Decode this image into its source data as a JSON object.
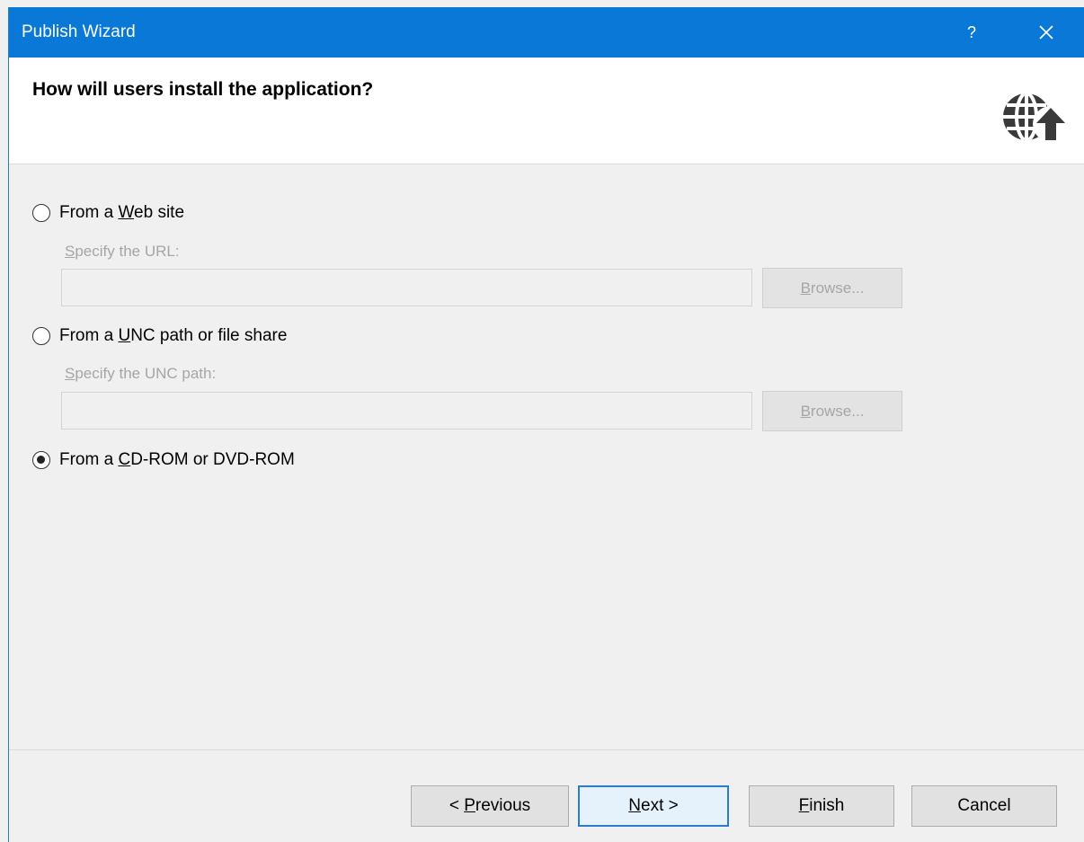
{
  "window": {
    "title": "Publish Wizard",
    "help_label": "?",
    "close_icon": "close-icon"
  },
  "header": {
    "heading": "How will users install the application?",
    "icon": "globe-upload-icon"
  },
  "options": [
    {
      "label_pre": "From a ",
      "label_mn": "W",
      "label_post": "eb site",
      "checked": false,
      "sub_label_pre": "",
      "sub_label_mn": "S",
      "sub_label_post": "pecify the URL:",
      "input_value": "",
      "browse_pre": "",
      "browse_mn": "B",
      "browse_post": "rowse..."
    },
    {
      "label_pre": "From a ",
      "label_mn": "U",
      "label_post": "NC path or file share",
      "checked": false,
      "sub_label_pre": "",
      "sub_label_mn": "S",
      "sub_label_post": "pecify the UNC path:",
      "input_value": "",
      "browse_pre": "",
      "browse_mn": "B",
      "browse_post": "rowse..."
    },
    {
      "label_pre": "From a ",
      "label_mn": "C",
      "label_post": "D-ROM or DVD-ROM",
      "checked": true
    }
  ],
  "footer": {
    "previous": {
      "pre": "< ",
      "mn": "P",
      "post": "revious"
    },
    "next": {
      "pre": "",
      "mn": "N",
      "post": "ext >"
    },
    "finish": {
      "pre": "",
      "mn": "F",
      "post": "inish"
    },
    "cancel": {
      "pre": "",
      "mn": "",
      "post": "Cancel"
    }
  },
  "colors": {
    "titlebar": "#0a78d7",
    "default_button_border": "#2b7bd0"
  }
}
